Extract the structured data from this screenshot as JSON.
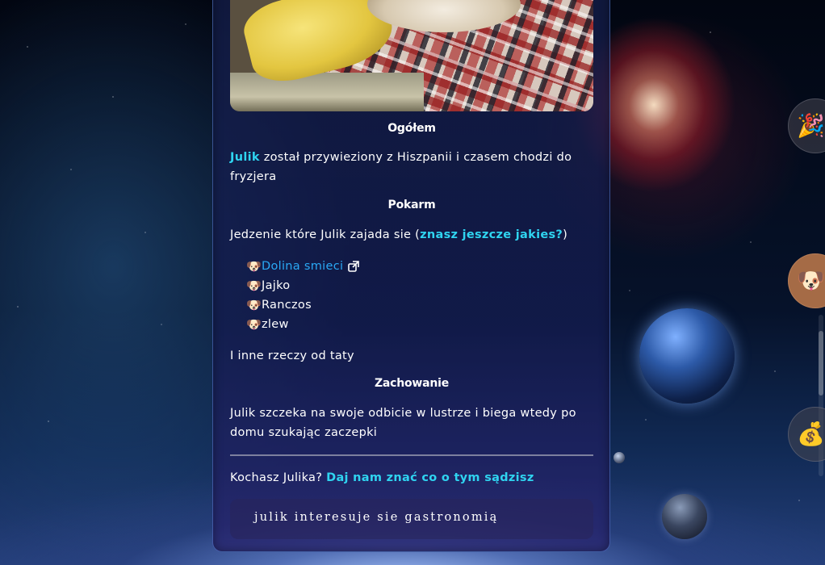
{
  "overview": {
    "heading": "Ogółem",
    "name_link": "Julik",
    "text": " został przywieziony z Hiszpanii i czasem chodzi do fryzjera"
  },
  "food": {
    "heading": "Pokarm",
    "intro_text": "Jedzenie które Julik zajada sie (",
    "intro_link": "znasz jeszcze jakies?",
    "intro_close": ")",
    "bullet_icon": "dog-face-icon",
    "items": [
      {
        "label": "Dolina smieci",
        "is_link": true,
        "icon": "external-link-icon"
      },
      {
        "label": "Jajko"
      },
      {
        "label": "Ranczos"
      },
      {
        "label": "zlew"
      }
    ],
    "outro": "I inne rzeczy od taty"
  },
  "behavior": {
    "heading": "Zachowanie",
    "text": "Julik szczeka na swoje odbicie w lustrze i biega wtedy po domu szukając zaczepki"
  },
  "feedback": {
    "question": "Kochasz Julika? ",
    "link": "Daj nam znać co o tym sądzisz"
  },
  "code_block": {
    "text": "julik interesuje sie gastronomią"
  },
  "side_rail": {
    "buttons": [
      {
        "emoji": "🎉",
        "icon": "party-popper-icon"
      },
      {
        "emoji": "🐶",
        "icon": "dog-face-icon"
      },
      {
        "emoji": "💰",
        "icon": "money-bag-icon"
      }
    ]
  },
  "colors": {
    "link": "#2fd4f0",
    "list_link": "#2aa9f5",
    "text": "#ffffff",
    "active_side_button": "#a56b46"
  }
}
